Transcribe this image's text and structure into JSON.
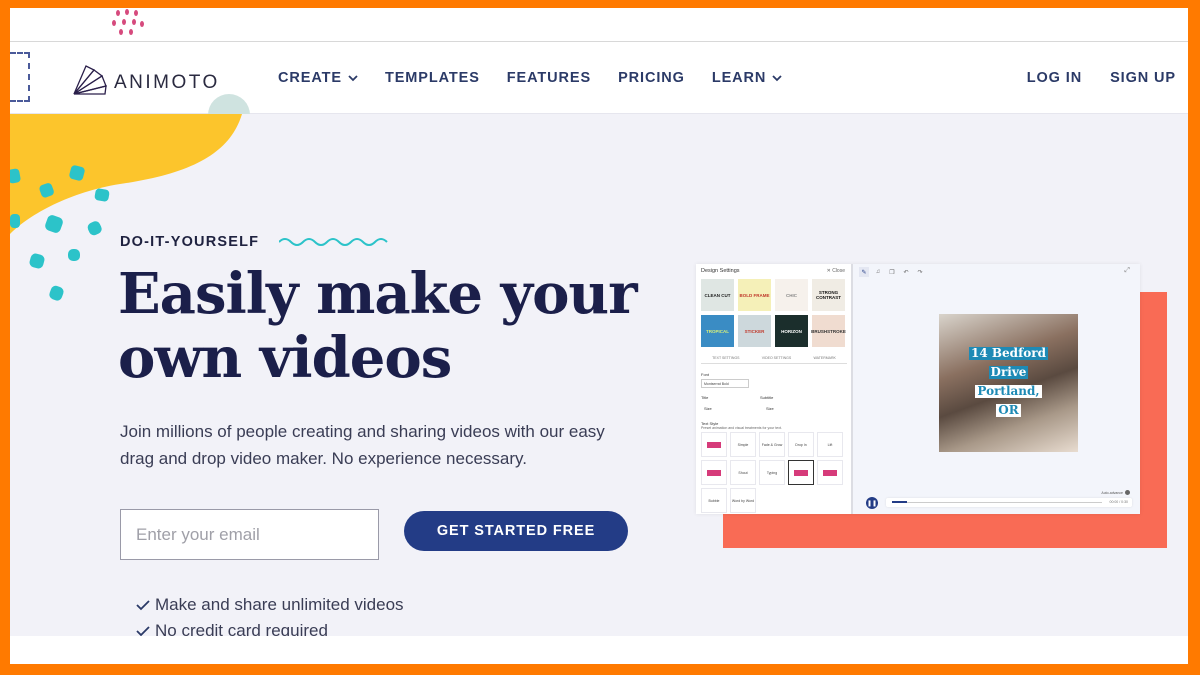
{
  "brand": {
    "name": "ANIMOTO"
  },
  "nav": {
    "items": [
      {
        "label": "CREATE",
        "has_dropdown": true
      },
      {
        "label": "TEMPLATES",
        "has_dropdown": false
      },
      {
        "label": "FEATURES",
        "has_dropdown": false
      },
      {
        "label": "PRICING",
        "has_dropdown": false
      },
      {
        "label": "LEARN",
        "has_dropdown": true
      }
    ],
    "login": "LOG IN",
    "signup": "SIGN UP"
  },
  "hero": {
    "eyebrow": "DO-IT-YOURSELF",
    "headline_line1": "Easily make your",
    "headline_line2": "own videos",
    "subtext": "Join millions of people creating and sharing videos with our easy drag and drop video maker. No experience necessary.",
    "email_placeholder": "Enter your email",
    "email_value": "",
    "cta_label": "GET STARTED FREE",
    "checks": [
      "Make and share unlimited videos",
      "No credit card required"
    ]
  },
  "mockup": {
    "panel_title": "Design Settings",
    "close_label": "✕ Close",
    "themes": [
      {
        "label": "CLEAN CUT",
        "bg": "#dfe6e3",
        "fg": "#222"
      },
      {
        "label": "BOLD FRAME",
        "bg": "#f5f0b8",
        "fg": "#c0392b"
      },
      {
        "label": "CHIC",
        "bg": "#f6f1ec",
        "fg": "#888"
      },
      {
        "label": "STRONG CONTRAST",
        "bg": "#f0ece4",
        "fg": "#111"
      },
      {
        "label": "TROPICAL",
        "bg": "#3a8cc4",
        "fg": "#d8f07a"
      },
      {
        "label": "STICKER",
        "bg": "#cdd8dc",
        "fg": "#c0392b"
      },
      {
        "label": "HORIZON",
        "bg": "#1b2e2c",
        "fg": "#ffffff"
      },
      {
        "label": "BRUSHSTROKE",
        "bg": "#f0dcd0",
        "fg": "#333"
      }
    ],
    "settings_tabs": [
      "TEXT SETTINGS",
      "VIDEO SETTINGS",
      "WATERMARK"
    ],
    "font_label": "Font",
    "font_value": "Montserrat Bold",
    "title_label": "Title",
    "subtitle_label": "Subtitle",
    "size_label": "Size",
    "text_style_label": "Text Style",
    "text_style_hint": "Preset animation and visual treatments for your text.",
    "text_styles": [
      "",
      "Simple",
      "Fade & Grow",
      "Drop In",
      "Lift",
      "",
      "Shout",
      "Typing",
      "",
      "",
      "Bubble",
      "Word by Word"
    ],
    "video_text": [
      "14 Bedford",
      "Drive",
      "Portland,",
      "OR"
    ],
    "progress": 0.07,
    "autoplay_label": "Auto-advance",
    "time_label": "00:00 / 0:30"
  },
  "colors": {
    "frame": "#ff7a00",
    "navy": "#233c86",
    "heading": "#1b1f4a",
    "coral": "#f96b55",
    "teal": "#2cc3c9",
    "yellow": "#fcc52c"
  }
}
